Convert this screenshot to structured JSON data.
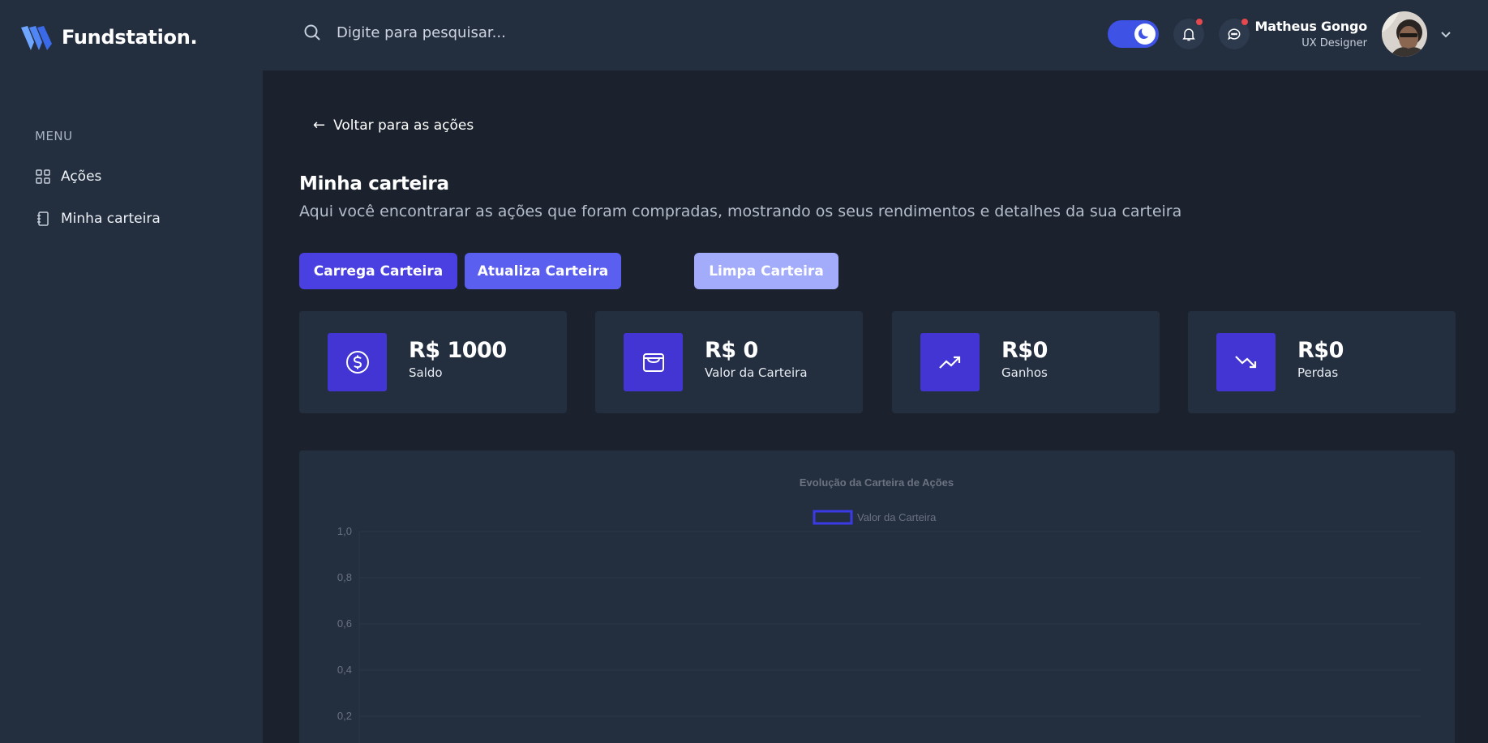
{
  "app": {
    "name": "Fundstation."
  },
  "header": {
    "search_placeholder": "Digite para pesquisar...",
    "user": {
      "name": "Matheus Gongo",
      "role": "UX Designer"
    }
  },
  "sidebar": {
    "menu_label": "MENU",
    "items": [
      {
        "label": "Ações",
        "icon": "grid-icon"
      },
      {
        "label": "Minha carteira",
        "icon": "notebook-icon"
      }
    ]
  },
  "main": {
    "back_label": "Voltar para as ações",
    "title": "Minha carteira",
    "subtitle": "Aqui você encontrarar as ações que foram compradas, mostrando os seus rendimentos e detalhes da sua carteira",
    "buttons": {
      "load": "Carrega Carteira",
      "update": "Atualiza Carteira",
      "clear": "Limpa Carteira"
    },
    "stats": [
      {
        "value": "R$ 1000",
        "label": "Saldo",
        "icon": "dollar-circle-icon"
      },
      {
        "value": "R$ 0",
        "label": "Valor da Carteira",
        "icon": "wallet-icon"
      },
      {
        "value": "R$0",
        "label": "Ganhos",
        "icon": "trending-up-icon"
      },
      {
        "value": "R$0",
        "label": "Perdas",
        "icon": "trending-down-icon"
      }
    ]
  },
  "colors": {
    "accent": "#4235d3",
    "button_primary": "#4a3fe0",
    "button_secondary": "#5b5ff0",
    "button_disabled": "#a3acfa",
    "toggle": "#3e52e6",
    "background": "#1b222d",
    "panel": "#232e3f",
    "notification_dot": "#e5484d"
  },
  "chart_data": {
    "type": "line",
    "title": "Evolução da Carteira de Ações",
    "series": [
      {
        "name": "Valor da Carteira",
        "values": []
      }
    ],
    "categories": [],
    "y_ticks": [
      "1,0",
      "0,8",
      "0,6",
      "0,4",
      "0,2"
    ],
    "ylim": [
      0,
      1
    ],
    "legend": "top-center",
    "grid": true
  }
}
